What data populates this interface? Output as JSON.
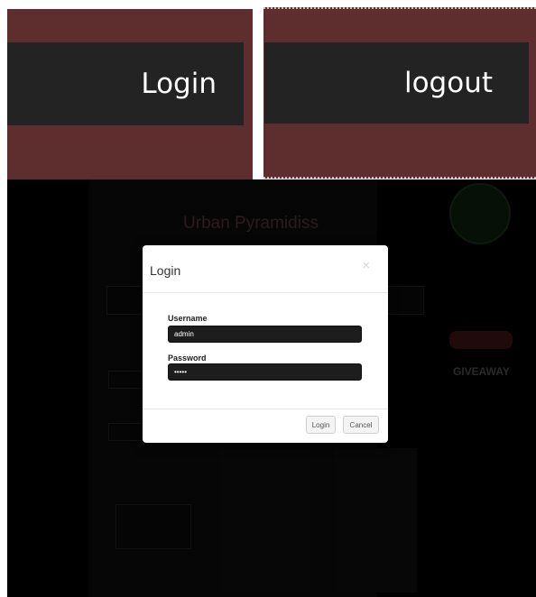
{
  "banner": {
    "login_label": "Login",
    "logout_label": "logout"
  },
  "site_background": {
    "title": "Urban Pyramidiss",
    "sidebar_logo": "GIVEAWAY"
  },
  "modal": {
    "title": "Login",
    "close_symbol": "×",
    "username_label": "Username",
    "username_value": "admin",
    "password_label": "Password",
    "password_value": "•••••",
    "login_button": "Login",
    "cancel_button": "Cancel"
  },
  "colors": {
    "banner_background": "#5e2e2f",
    "banner_button": "#232323",
    "overlay": "#000000",
    "input_background": "#1d1d1d"
  }
}
